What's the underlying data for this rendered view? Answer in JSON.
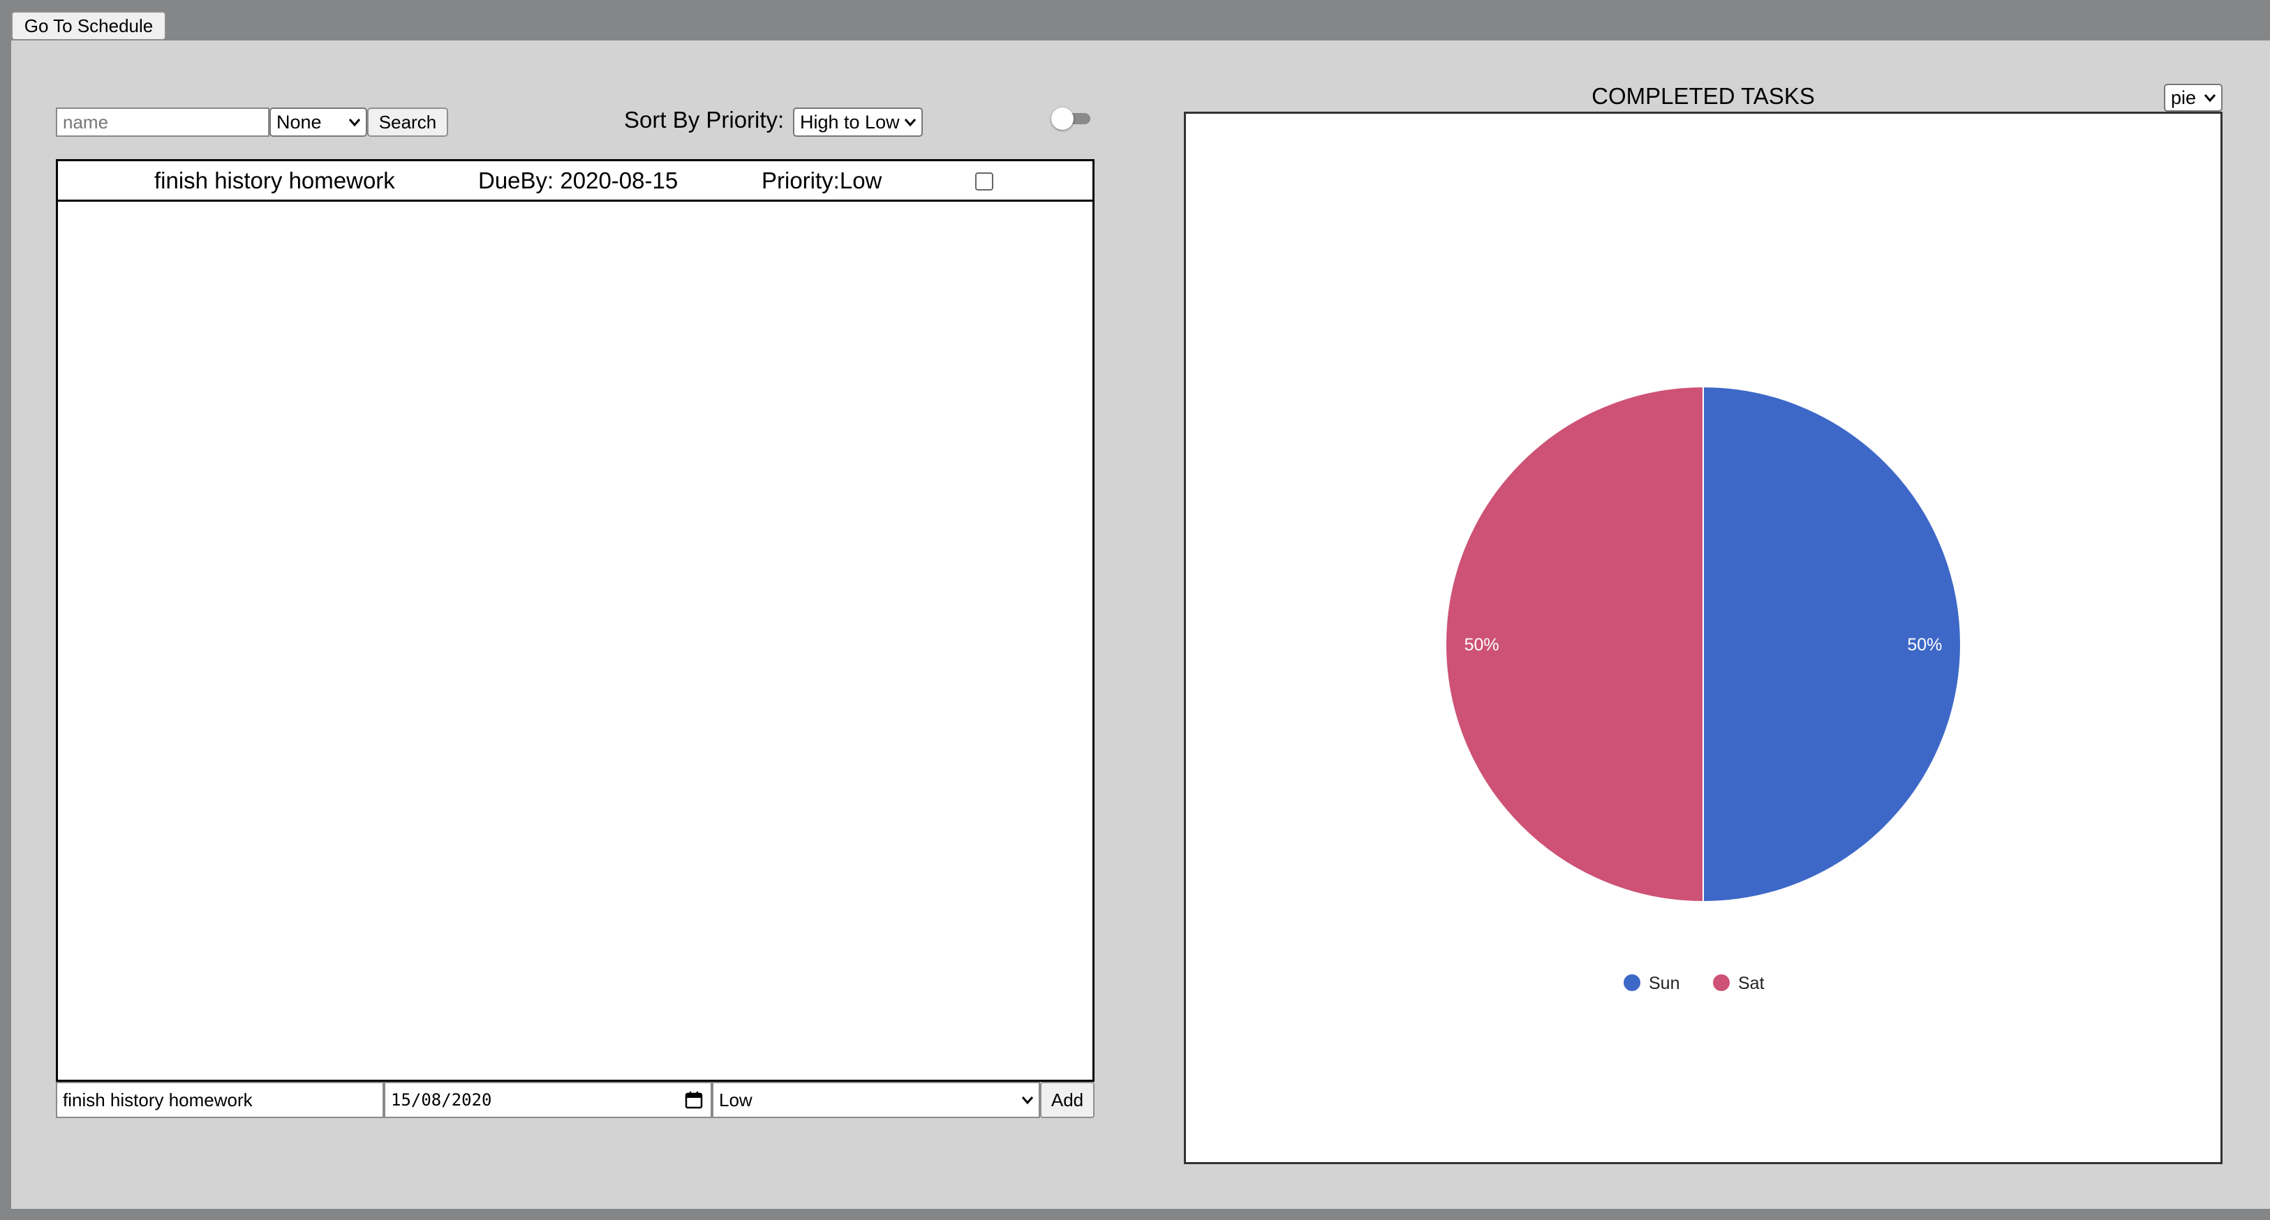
{
  "nav": {
    "go_to_schedule": "Go To Schedule"
  },
  "search": {
    "name_placeholder": "name",
    "filter_selected": "None",
    "search_label": "Search"
  },
  "sort": {
    "label": "Sort By Priority:",
    "selected": "High to Low"
  },
  "toggle": {
    "on": false
  },
  "tasks": [
    {
      "name": "finish history homework",
      "due": "DueBy: 2020-08-15",
      "priority": "Priority:Low",
      "done": false
    }
  ],
  "add_form": {
    "name_value": "finish history homework",
    "date_value": "15/08/2020",
    "priority_selected": "Low",
    "add_label": "Add"
  },
  "chart_panel": {
    "title": "COMPLETED TASKS",
    "type_selected": "pie"
  },
  "colors": {
    "sun": "#3d68c7",
    "sat": "#cd5275"
  },
  "chart_data": {
    "type": "pie",
    "title": "COMPLETED TASKS",
    "labels": [
      "Sun",
      "Sat"
    ],
    "values": [
      50,
      50
    ],
    "data_labels": [
      "50%",
      "50%"
    ],
    "colors": [
      "#3d68c7",
      "#cd5275"
    ],
    "legend": "bottom"
  }
}
